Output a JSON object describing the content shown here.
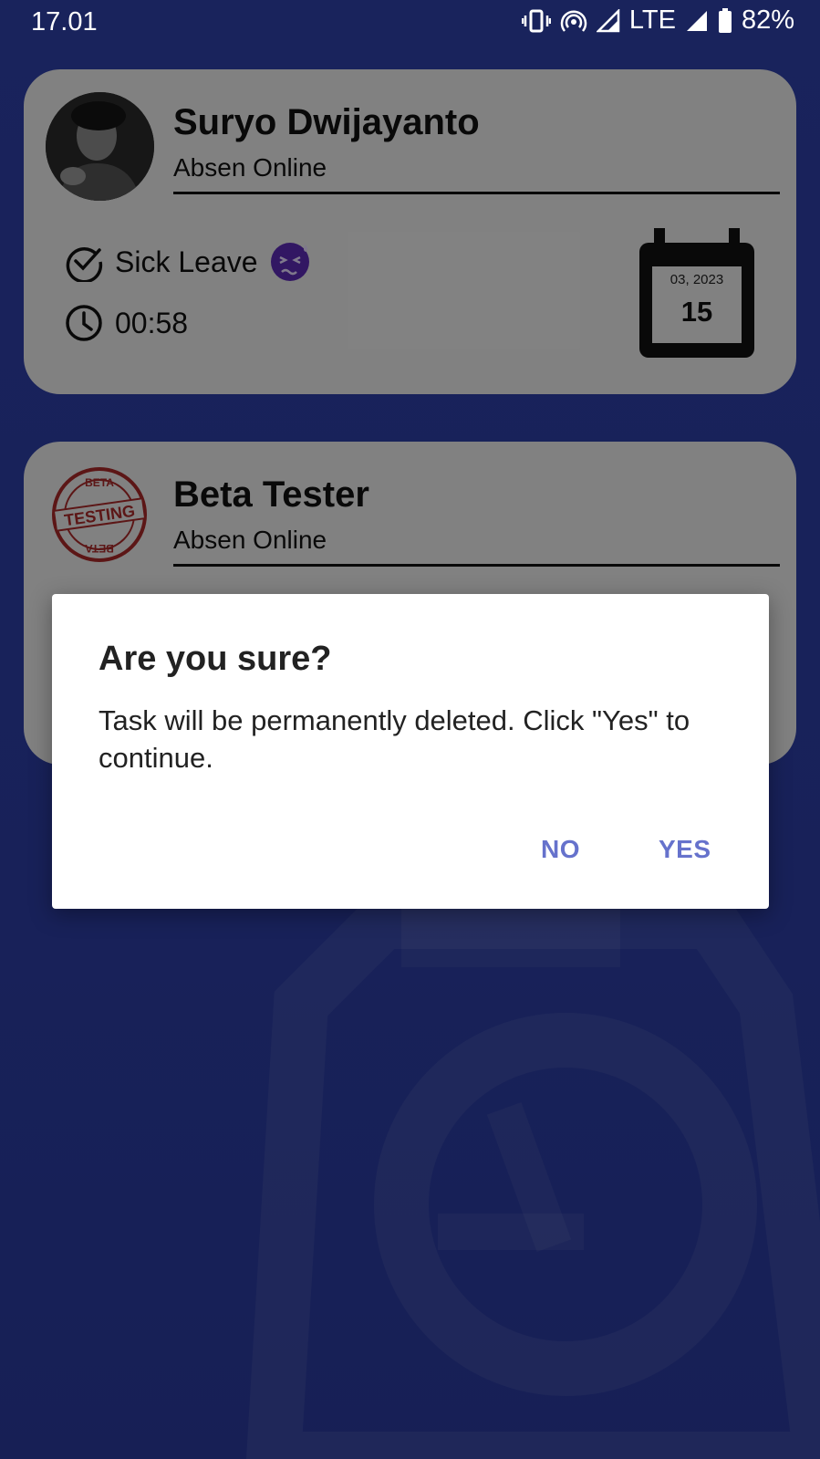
{
  "status_bar": {
    "time": "17.01",
    "network": "LTE",
    "battery": "82%",
    "icons": [
      "vibrate-icon",
      "hotspot-icon",
      "signal-icon",
      "signal-icon",
      "battery-icon"
    ]
  },
  "cards": [
    {
      "name": "Suryo Dwijayanto",
      "subtitle": "Absen Online",
      "status": "Sick Leave",
      "time": "00:58",
      "calendar_month": "03, 2023",
      "calendar_day": "15",
      "avatar": "profile-photo",
      "status_emoji": "sick-face-icon"
    },
    {
      "name": "Beta Tester",
      "subtitle": "Absen Online",
      "stamp_top": "BETA",
      "stamp_center": "TESTING",
      "stamp_bottom": "BETA"
    }
  ],
  "dialog": {
    "title": "Are you sure?",
    "message": "Task will be permanently deleted. Click \"Yes\" to continue.",
    "no_label": "NO",
    "yes_label": "YES"
  },
  "colors": {
    "background": "#2f40a8",
    "dialog_button": "#6672cc",
    "sick_emoji": "#5b2bb5"
  }
}
